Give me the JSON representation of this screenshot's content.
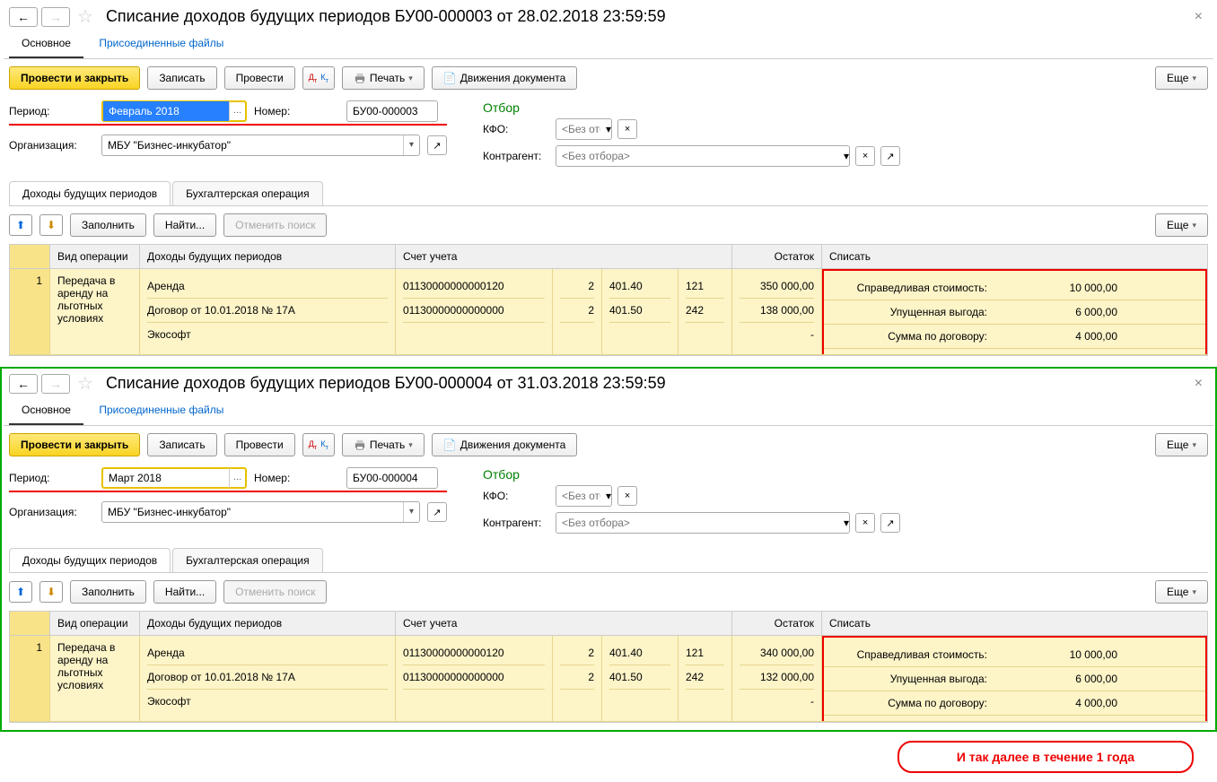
{
  "docs": [
    {
      "title": "Списание доходов будущих периодов БУ00-000003 от 28.02.2018 23:59:59",
      "period": "Февраль 2018",
      "period_selected": true,
      "number": "БУ00-000003",
      "org": "МБУ \"Бизнес-инкубатор\"",
      "rows": [
        {
          "r1": "350 000,00",
          "r2": "138 000,00"
        }
      ],
      "wrap_class": ""
    },
    {
      "title": "Списание доходов будущих периодов БУ00-000004 от 31.03.2018 23:59:59",
      "period": "Март 2018",
      "period_selected": false,
      "number": "БУ00-000004",
      "org": "МБУ \"Бизнес-инкубатор\"",
      "rows": [
        {
          "r1": "340 000,00",
          "r2": "132 000,00"
        }
      ],
      "wrap_class": "green"
    }
  ],
  "nav": {
    "main": "Основное",
    "files": "Присоединенные файлы"
  },
  "toolbar": {
    "post_close": "Провести и закрыть",
    "save": "Записать",
    "post": "Провести",
    "print": "Печать",
    "movements": "Движения документа",
    "more": "Еще"
  },
  "labels": {
    "period": "Период:",
    "number": "Номер:",
    "org": "Организация:",
    "filter_title": "Отбор",
    "kfo": "КФО:",
    "counterparty": "Контрагент:",
    "kfo_placeholder": "<Без отб...",
    "cp_placeholder": "<Без отбора>"
  },
  "tabs2": {
    "t1": "Доходы будущих периодов",
    "t2": "Бухгалтерская операция"
  },
  "sub_toolbar": {
    "fill": "Заполнить",
    "find": "Найти...",
    "cancel_find": "Отменить поиск",
    "more": "Еще"
  },
  "thead": {
    "op": "Вид операции",
    "income": "Доходы будущих периодов",
    "account": "Счет учета",
    "rest": "Остаток",
    "write": "Списать"
  },
  "row_data": {
    "num": "1",
    "op_lines": [
      "Передача в",
      "аренду на",
      "льготных",
      "условиях"
    ],
    "income_lines": [
      "Аренда",
      "Договор от 10.01.2018 № 17А",
      "Экософт"
    ],
    "acc_lines": [
      "01130000000000120",
      "01130000000000000",
      ""
    ],
    "n2_lines": [
      "2",
      "2",
      ""
    ],
    "n3_lines": [
      "401.40",
      "401.50",
      ""
    ],
    "n4_lines": [
      "121",
      "242",
      ""
    ],
    "rest3": "-",
    "write_labels": [
      "Справедливая стоимость:",
      "Упущенная выгода:",
      "Сумма по договору:"
    ],
    "write_vals": [
      "10 000,00",
      "6 000,00",
      "4 000,00"
    ]
  },
  "note": "И так далее в течение 1 года"
}
